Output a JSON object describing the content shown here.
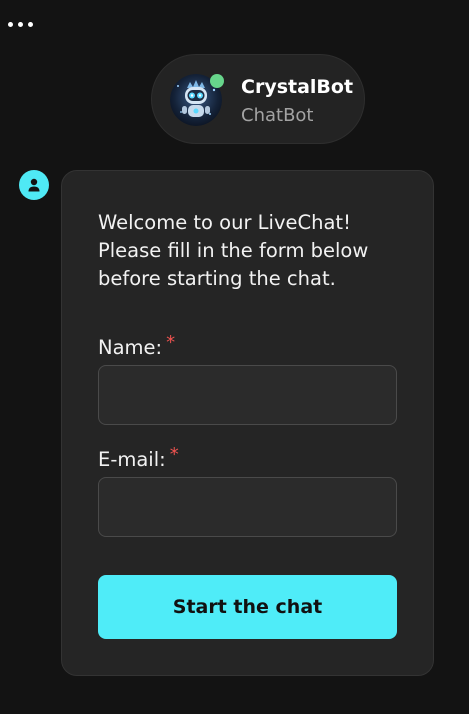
{
  "header": {
    "more_icon": "ellipsis-horizontal-icon"
  },
  "bot": {
    "name": "CrystalBot",
    "role": "ChatBot",
    "status": "online",
    "status_color": "#67d58b"
  },
  "form": {
    "welcome_text": "Welcome to our LiveChat! Please fill in the form below before starting the chat.",
    "fields": [
      {
        "label": "Name:",
        "required_marker": "*",
        "value": "",
        "placeholder": ""
      },
      {
        "label": "E-mail:",
        "required_marker": "*",
        "value": "",
        "placeholder": ""
      }
    ],
    "submit_label": "Start the chat"
  },
  "colors": {
    "accent": "#4fecf8",
    "background": "#131313",
    "card": "#252525",
    "required": "#ef5350"
  }
}
